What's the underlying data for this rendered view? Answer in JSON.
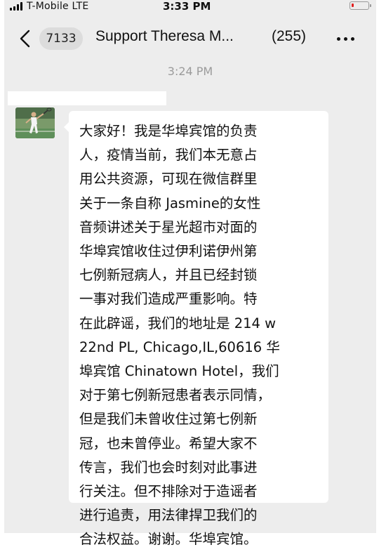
{
  "status_bar": {
    "carrier": "T-Mobile  LTE",
    "time": "3:33 PM",
    "signal_icon": "signal-bars-icon",
    "battery_icon": "battery-low-icon",
    "battery_color": "#e02020"
  },
  "nav": {
    "back_icon": "chevron-left-icon",
    "unread_count": "7133",
    "title": "Support Theresa M...",
    "member_count": "(255)",
    "more_icon": "more-dots-icon"
  },
  "chat": {
    "timestamp": "3:24 PM",
    "message": {
      "avatar_icon": "tennis-player-avatar",
      "lines": [
        "大家好！我是华埠宾馆的负责",
        "人，疫情当前，我们本无意占",
        "用公共资源，可现在微信群里",
        "关于一条自称 Jasmine的女性",
        "音频讲述关于星光超市对面的",
        "华埠宾馆收住过伊利诺伊州第",
        "七例新冠病人，并且已经封锁",
        "一事对我们造成严重影响。特",
        "在此辟谣，我们的地址是 214 w",
        "22nd PL, Chicago,IL,60616 华",
        "埠宾馆 Chinatown Hotel，我们",
        "对于第七例新冠患者表示同情，",
        "但是我们未曾收住过第七例新",
        "冠，也未曾停业。希望大家不",
        "传言，我们也会时刻对此事进",
        "行关注。但不排除对于造谣者",
        "进行追责，用法律捍卫我们的",
        "合法权益。谢谢。华埠宾馆。"
      ]
    }
  },
  "colors": {
    "background": "#ededed",
    "bubble": "#ffffff",
    "timestamp": "#9b9b9b"
  }
}
